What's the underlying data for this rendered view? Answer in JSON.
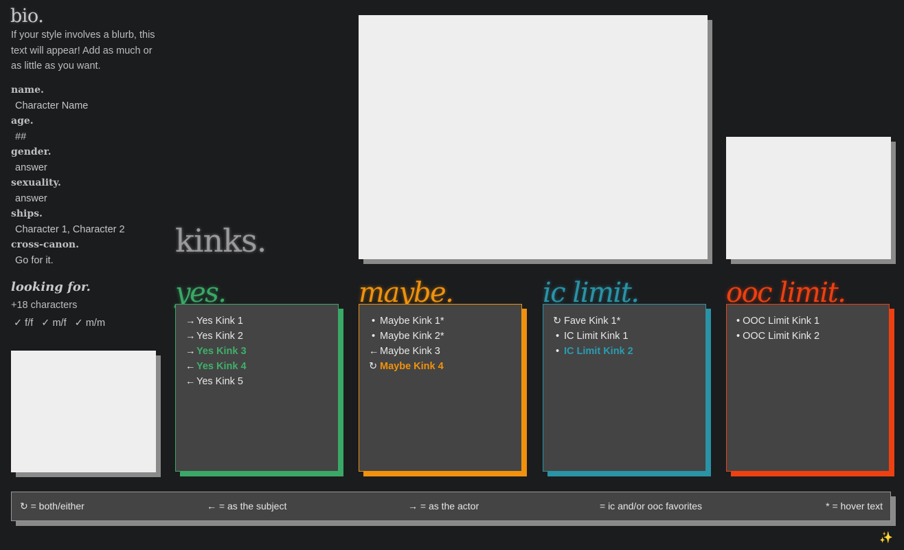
{
  "bio": {
    "title": "bio.",
    "text": "If your style involves a blurb, this text will appear! Add as much or as little as you want."
  },
  "fields": [
    {
      "label": "name.",
      "value": "Character Name"
    },
    {
      "label": "age.",
      "value": "##"
    },
    {
      "label": "gender.",
      "value": "answer"
    },
    {
      "label": "sexuality.",
      "value": "answer"
    },
    {
      "label": "ships.",
      "value": "Character 1, Character 2"
    },
    {
      "label": "cross-canon.",
      "value": "Go for it."
    }
  ],
  "looking_for": {
    "title": "looking for.",
    "count": "+18 characters",
    "options": [
      "✓ f/f",
      "✓ m/f",
      "✓ m/m"
    ]
  },
  "kinks": {
    "title": "kinks."
  },
  "columns": {
    "yes": {
      "title": "yes.",
      "color": "#3aa866",
      "items": [
        {
          "symbol": "→",
          "text": "Yes Kink 1"
        },
        {
          "symbol": "→",
          "text": "Yes Kink 2"
        },
        {
          "symbol": "→",
          "text": "Yes Kink 3"
        },
        {
          "symbol": "←",
          "text": "Yes Kink 4"
        },
        {
          "symbol": "←",
          "text": "Yes Kink 5"
        }
      ]
    },
    "maybe": {
      "title": "maybe.",
      "color": "#f0920d",
      "items": [
        {
          "symbol": "•",
          "text": "Maybe Kink 1*"
        },
        {
          "symbol": "•",
          "text": "Maybe Kink 2*"
        },
        {
          "symbol": "←",
          "text": "Maybe Kink 3"
        },
        {
          "symbol": "↻",
          "text": "Maybe Kink 4"
        }
      ]
    },
    "ic": {
      "title": "ic limit.",
      "color": "#2a93a6",
      "items": [
        {
          "symbol": "↻",
          "text": "Fave Kink 1*"
        },
        {
          "symbol": "•",
          "text": "IC Limit Kink 1"
        },
        {
          "symbol": "•",
          "text": "IC Limit Kink 2"
        }
      ]
    },
    "ooc": {
      "title": "ooc limit.",
      "color": "#ee4011",
      "items": [
        {
          "text": "• OOC Limit Kink 1"
        },
        {
          "text": "• OOC Limit Kink 2"
        }
      ]
    }
  },
  "legend": {
    "both": "↻ = both/either",
    "subject": "← = as the subject",
    "actor": "→ = as the actor",
    "favorites": "= ic and/or ooc favorites",
    "hover": "* = hover text"
  },
  "sparkle_icon": "✨"
}
